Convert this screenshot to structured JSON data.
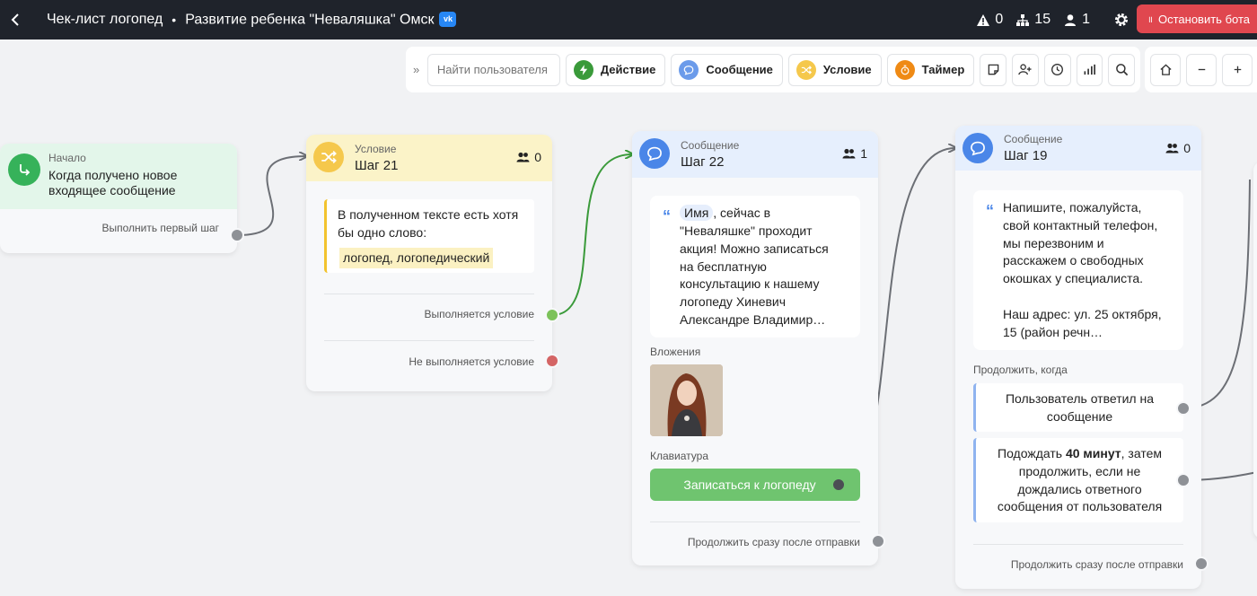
{
  "header": {
    "bot_name": "Чек-лист логопед",
    "separator": "•",
    "project": "Развитие ребенка \"Неваляшка\" Омск",
    "network_badge": "vk",
    "stats": [
      {
        "icon": "warning-icon",
        "value": "0"
      },
      {
        "icon": "sitemap-icon",
        "value": "15"
      },
      {
        "icon": "user-icon",
        "value": "1"
      }
    ],
    "stop_label": "Остановить бота"
  },
  "toolbar": {
    "search_placeholder": "Найти пользователя",
    "buttons": [
      {
        "label": "Действие",
        "icon": "lightning-icon",
        "color": "#3a9a3a"
      },
      {
        "label": "Сообщение",
        "icon": "chat-icon",
        "color": "#6b9bea"
      },
      {
        "label": "Условие",
        "icon": "shuffle-icon",
        "color": "#f5c84c"
      },
      {
        "label": "Таймер",
        "icon": "timer-icon",
        "color": "#ef8a15"
      }
    ]
  },
  "nodes": {
    "start": {
      "type": "Начало",
      "text": "Когда получено новое входящее сообщение",
      "output": "Выполнить первый шаг"
    },
    "cond": {
      "type": "Условие",
      "name": "Шаг 21",
      "count": "0",
      "text": "В полученном тексте есть хотя бы одно слово:",
      "keywords": "логопед, логопедический",
      "out_true": "Выполняется условие",
      "out_false": "Не выполняется условие"
    },
    "msg22": {
      "type": "Сообщение",
      "name": "Шаг 22",
      "count": "1",
      "var": "Имя",
      "text_after_var": ", сейчас в",
      "text": "\"Неваляшке\" проходит\nакция! Можно записаться\nна бесплатную\nконсультацию к нашему\nлогопеду Хиневич\nАлександре Владимир…",
      "attachments_label": "Вложения",
      "keyboard_label": "Клавиатура",
      "button_label": "Записаться к логопеду",
      "continue_label": "Продолжить сразу после отправки"
    },
    "msg19": {
      "type": "Сообщение",
      "name": "Шаг 19",
      "count": "0",
      "text": "Напишите, пожалуйста,\nсвой контактный телефон,\nмы перезвоним и\nрасскажем о свободных\nокошках у специалиста.\n\nНаш адрес: ул. 25 октября,\n15 (район речн…",
      "continue_when": "Продолжить, когда",
      "cond1": "Пользователь ответил на сообщение",
      "cond2_pre": "Подождать ",
      "cond2_bold": "40 минут",
      "cond2_post": ", затем продолжить, если не дождались ответного сообщения от пользователя",
      "continue_label": "Продолжить сразу после отправки"
    }
  },
  "colors": {
    "start_head": "#e3f6ea",
    "cond_head": "#fbf3c8",
    "msg_head": "#e6effd",
    "edge_green": "#3a9a3a",
    "edge_gray": "#6c6f75",
    "port_true": "#7cc25a",
    "port_false": "#d46565",
    "button_green": "#6fc46f"
  }
}
